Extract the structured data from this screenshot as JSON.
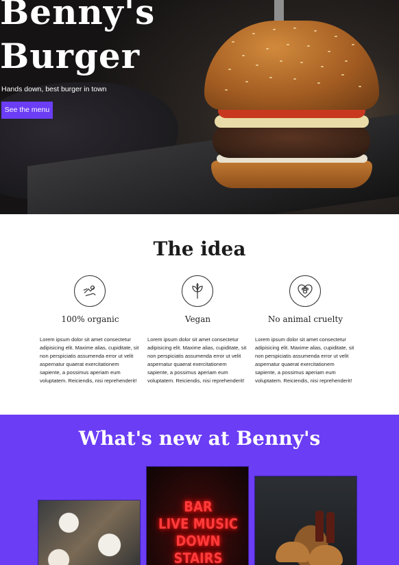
{
  "hero": {
    "title_line1": "Benny's",
    "title_line2": "Burger",
    "subtitle": "Hands down, best burger in town",
    "cta_label": "See the menu"
  },
  "idea": {
    "title": "The idea",
    "features": [
      {
        "icon": "organic-icon",
        "title": "100% organic",
        "text": "Lorem ipsum dolor sit amet consectetur adipisicing elit. Maxime alias, cupiditate, sit non perspiciatis assumenda error ut velit aspernatur quaerat exercitationem sapiente, a possimus aperiam eum voluptatem. Reiciendis, nisi reprehenderit!"
      },
      {
        "icon": "plant-icon",
        "title": "Vegan",
        "text": "Lorem ipsum dolor sit amet consectetur adipisicing elit. Maxime alias, cupiditate, sit non perspiciatis assumenda error ut velit aspernatur quaerat exercitationem sapiente, a possimus aperiam eum voluptatem. Reiciendis, nisi reprehenderit!"
      },
      {
        "icon": "heart-paw-icon",
        "title": "No animal cruelty",
        "text": "Lorem ipsum dolor sit amet consectetur adipisicing elit. Maxime alias, cupiditate, sit non perspiciatis assumenda error ut velit aspernatur quaerat exercitationem sapiente, a possimus aperiam eum voluptatem. Reiciendis, nisi reprehenderit!"
      }
    ]
  },
  "news": {
    "title": "What's new at Benny's",
    "cards": [
      {
        "image": "table-with-burgers-photo"
      },
      {
        "image": "neon-sign-photo",
        "neon_lines": [
          "BAR",
          "LIVE MUSIC",
          "DOWN",
          "STAIRS"
        ]
      },
      {
        "image": "burgers-and-cola-photo"
      }
    ]
  },
  "colors": {
    "accent": "#6b3df5",
    "hero_text": "#ffffff",
    "neon": "#ff3b3b"
  }
}
